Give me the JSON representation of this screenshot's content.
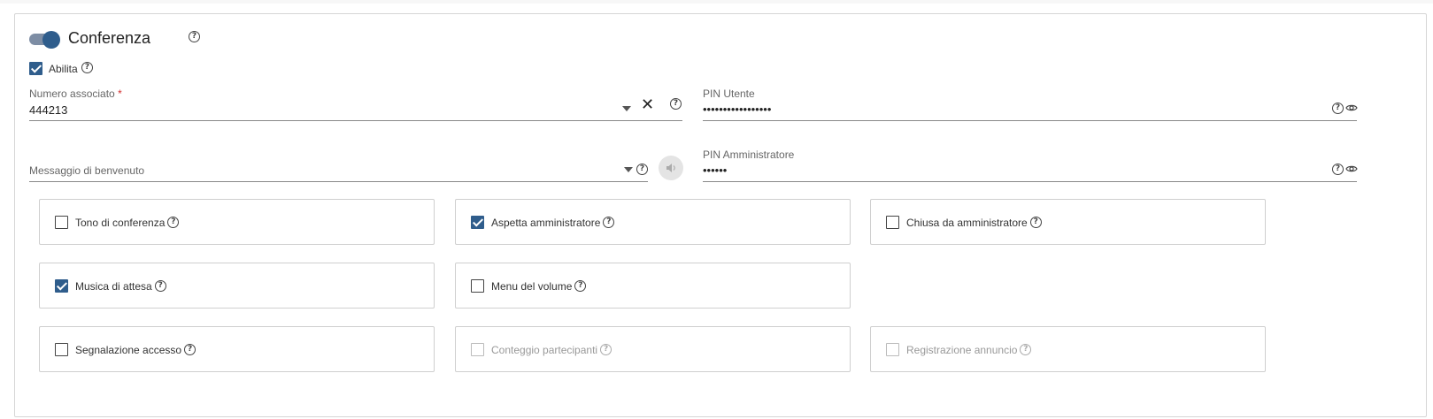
{
  "section": {
    "title": "Conferenza",
    "toggle_on": true
  },
  "enable": {
    "label": "Abilita",
    "checked": true
  },
  "fields": {
    "numero_associato": {
      "label": "Numero associato",
      "required_mark": "*",
      "value": "444213"
    },
    "pin_utente": {
      "label": "PIN Utente",
      "value": "•••••••••••••••••"
    },
    "messaggio_benvenuto": {
      "placeholder": "Messaggio di benvenuto"
    },
    "pin_amministratore": {
      "label": "PIN Amministratore",
      "value": "••••••"
    }
  },
  "options": [
    {
      "label": "Tono di conferenza",
      "checked": false,
      "disabled": false
    },
    {
      "label": "Aspetta amministratore",
      "checked": true,
      "disabled": false
    },
    {
      "label": "Chiusa da amministratore",
      "checked": false,
      "disabled": false
    },
    {
      "label": "Musica di attesa",
      "checked": true,
      "disabled": false
    },
    {
      "label": "Menu del volume",
      "checked": false,
      "disabled": false
    },
    {
      "label": "Segnalazione accesso",
      "checked": false,
      "disabled": false
    },
    {
      "label": "Conteggio partecipanti",
      "checked": false,
      "disabled": true
    },
    {
      "label": "Registrazione annuncio",
      "checked": false,
      "disabled": true
    }
  ],
  "icons": {
    "help": "?",
    "clear": "✕"
  },
  "colors": {
    "accent": "#2f5d8c",
    "required": "#d32f2f"
  }
}
